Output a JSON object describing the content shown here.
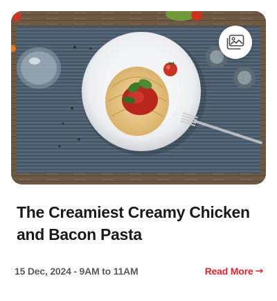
{
  "card": {
    "title": "The Creamiest Creamy Chicken and Bacon Pasta",
    "date": "15 Dec, 2024 - 9AM to 11AM",
    "read_more_label": "Read More",
    "read_more_arrow": "→",
    "gallery_icon": "gallery-icon",
    "image_alt": "Spaghetti with tomato sauce and basil on a white plate",
    "colors": {
      "title": "#1a1a1a",
      "date": "#5a5a5a",
      "accent": "#e4222e"
    }
  }
}
